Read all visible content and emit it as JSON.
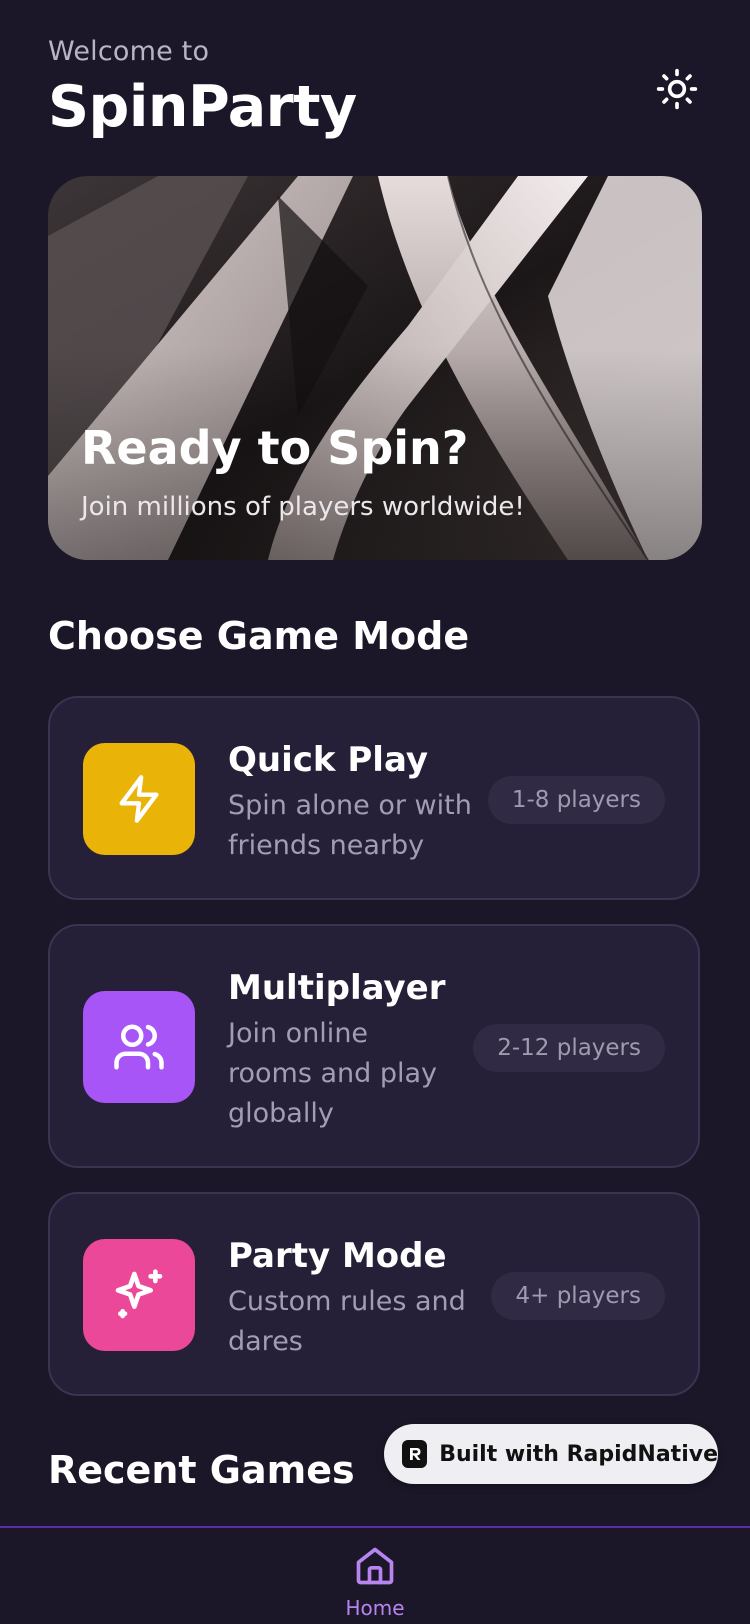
{
  "header": {
    "welcome": "Welcome to",
    "app_title": "SpinParty",
    "theme_icon": "sun-icon"
  },
  "hero": {
    "title": "Ready to Spin?",
    "subtitle": "Join millions of players worldwide!"
  },
  "game_modes": {
    "section_title": "Choose Game Mode",
    "items": [
      {
        "name": "Quick Play",
        "description": "Spin alone or with friends nearby",
        "players": "1-8 players",
        "icon": "lightning-icon",
        "color": "#eab308"
      },
      {
        "name": "Multiplayer",
        "description": "Join online rooms and play globally",
        "players": "2-12 players",
        "icon": "users-icon",
        "color": "#a855f7"
      },
      {
        "name": "Party Mode",
        "description": "Custom rules and dares",
        "players": "4+ players",
        "icon": "sparkles-icon",
        "color": "#ec4899"
      }
    ]
  },
  "recent": {
    "section_title": "Recent Games"
  },
  "badge": {
    "label": "Built with RapidNative"
  },
  "tab_bar": {
    "home_label": "Home",
    "accent": "#b784f0"
  }
}
